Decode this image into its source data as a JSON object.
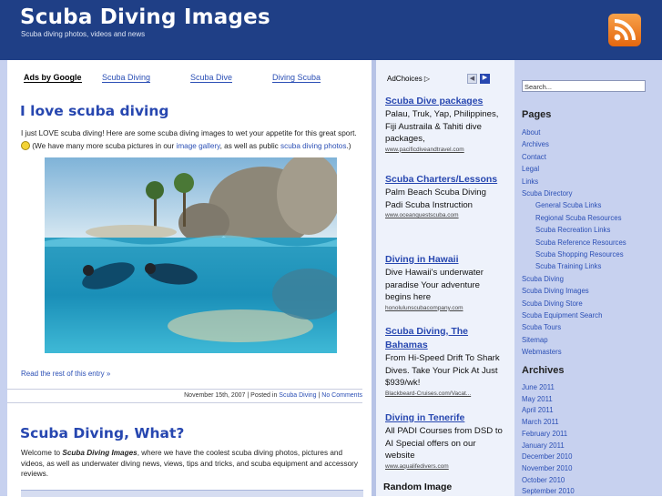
{
  "header": {
    "title": "Scuba Diving Images",
    "tagline": "Scuba diving photos, videos and news",
    "rss_icon": "rss-feed-icon"
  },
  "ads": {
    "ads_by": "Ads by Google",
    "links": [
      "Scuba Diving",
      "Scuba Dive",
      "Diving Scuba"
    ]
  },
  "post1": {
    "title": "I love scuba diving",
    "text_a": "I just LOVE scuba diving! Here are some scuba diving images to wet your appetite for this great sport.",
    "text_b": "(We have many more scuba pictures in our",
    "link_gallery": "image gallery",
    "text_c": ", as well as public",
    "link_photos": "scuba diving photos",
    "text_d": ".)",
    "read_more": "Read the rest of this entry »",
    "meta_date": "November 15th, 2007",
    "meta_posted": " | Posted in ",
    "meta_category": "Scuba Diving",
    "meta_sep": " | ",
    "meta_comments": "No Comments"
  },
  "post2": {
    "title": "Scuba Diving, What?",
    "text_a": "Welcome to ",
    "text_bold": "Scuba Diving Images",
    "text_b": ", where we have the coolest scuba diving photos, pictures and videos, as well as underwater diving news, views, tips and tricks, and scuba equipment and accessory reviews."
  },
  "adcolumn": {
    "adchoices": "AdChoices",
    "prev_arrow": "◀",
    "next_arrow": "▶",
    "items": [
      {
        "title": "Scuba Dive packages",
        "body": "Palau, Truk, Yap, Philippines, Fiji Austraila & Tahiti dive packages,",
        "url": "www.pacificdiveandtravel.com"
      },
      {
        "title": "Scuba Charters/Lessons",
        "body": "Palm Beach Scuba Diving Padi Scuba Instruction",
        "url": "www.oceanquestscuba.com"
      },
      {
        "title": "Diving in Hawaii",
        "body": "Dive Hawaii's underwater paradise Your adventure begins here",
        "url": "honolulunscubacompany.com"
      },
      {
        "title": "Scuba Diving, The Bahamas",
        "body": "From Hi-Speed Drift To Shark Dives. Take Your Pick At Just $939/wk!",
        "url": "Blackbeard-Cruises.com/Vacat..."
      },
      {
        "title": "Diving in Tenerife",
        "body": "All PADI Courses from DSD to AI Special offers on our website",
        "url": "www.aqualifedivers.com"
      }
    ],
    "random_image": "Random Image"
  },
  "sidebar": {
    "search_value": "Search...",
    "pages_heading": "Pages",
    "pages": [
      {
        "label": "About",
        "indent": false
      },
      {
        "label": "Archives",
        "indent": false
      },
      {
        "label": "Contact",
        "indent": false
      },
      {
        "label": "Legal",
        "indent": false
      },
      {
        "label": "Links",
        "indent": false
      },
      {
        "label": "Scuba Directory",
        "indent": false
      },
      {
        "label": "General Scuba Links",
        "indent": true
      },
      {
        "label": "Regional Scuba Resources",
        "indent": true
      },
      {
        "label": "Scuba Recreation Links",
        "indent": true
      },
      {
        "label": "Scuba Reference Resources",
        "indent": true
      },
      {
        "label": "Scuba Shopping Resources",
        "indent": true
      },
      {
        "label": "Scuba Training Links",
        "indent": true
      },
      {
        "label": "Scuba Diving",
        "indent": false
      },
      {
        "label": "Scuba Diving Images",
        "indent": false
      },
      {
        "label": "Scuba Diving Store",
        "indent": false
      },
      {
        "label": "Scuba Equipment Search",
        "indent": false
      },
      {
        "label": "Scuba Tours",
        "indent": false
      },
      {
        "label": "Sitemap",
        "indent": false
      },
      {
        "label": "Webmasters",
        "indent": false
      }
    ],
    "archives_heading": "Archives",
    "archives": [
      "June 2011",
      "May 2011",
      "April 2011",
      "March 2011",
      "February 2011",
      "January 2011",
      "December 2010",
      "November 2010",
      "October 2010",
      "September 2010"
    ]
  },
  "colors": {
    "header_bg": "#1f3f86",
    "link": "#2b4fb5",
    "sidebar_bg": "#c7d1ef"
  }
}
